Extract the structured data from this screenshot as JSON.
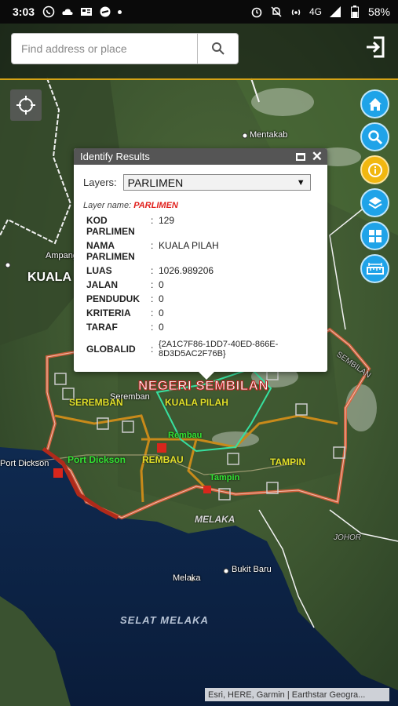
{
  "status_bar": {
    "time": "3:03",
    "battery": "58%",
    "network": "4G"
  },
  "search": {
    "placeholder": "Find address or place"
  },
  "popup": {
    "title": "Identify Results",
    "layers_label": "Layers:",
    "layers_selected": "PARLIMEN",
    "layer_name_label": "Layer name:",
    "layer_name_value": "PARLIMEN",
    "attributes": [
      {
        "key": "KOD PARLIMEN",
        "value": "129"
      },
      {
        "key": "NAMA PARLIMEN",
        "value": "KUALA PILAH"
      },
      {
        "key": "LUAS",
        "value": "1026.989206"
      },
      {
        "key": "JALAN",
        "value": "0"
      },
      {
        "key": "PENDUDUK",
        "value": "0"
      },
      {
        "key": "KRITERIA",
        "value": "0"
      },
      {
        "key": "TARAF",
        "value": "0"
      },
      {
        "key": "GLOBALID",
        "value": "{2A1C7F86-1DD7-40ED-866E-8D3D5AC2F76B}"
      }
    ]
  },
  "map_labels": {
    "mentakab": "Mentakab",
    "ampang": "Ampang",
    "kuala": "KUALA",
    "negeri": "NEGERI SEMBILAN",
    "seremban_town": "Seremban",
    "seremban": "SEREMBAN",
    "kuala_pilah": "KUALA PILAH",
    "rembau_town": "Rembau",
    "port_dickson_town": "Port Dickson",
    "port_dickson": "Port Dickson",
    "rembau": "REMBAU",
    "tampin_town": "Tampin",
    "tampin": "TAMPIN",
    "melaka_state": "MELAKA",
    "bukit_baru": "Bukit Baru",
    "melaka_town": "Melaka",
    "selat": "SELAT MELAKA",
    "sembilan_edge": "SEMBILAN",
    "johor_edge": "JOHOR"
  },
  "attribution": "Esri, HERE, Garmin | Earthstar Geogra...",
  "colors": {
    "accent": "#d4a316",
    "tool_blue": "#1fa3e8",
    "tool_yellow": "#f1b710",
    "boundary": "#e8603c"
  }
}
